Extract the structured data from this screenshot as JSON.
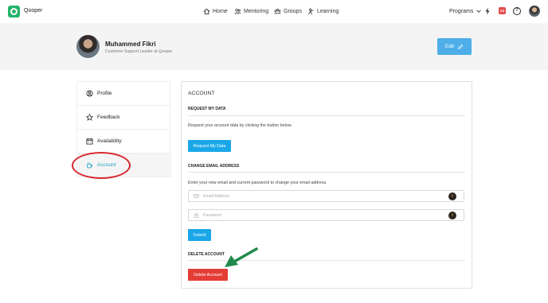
{
  "app": {
    "name": "Qooper"
  },
  "nav": {
    "links": [
      {
        "label": "Home",
        "icon": "home-icon"
      },
      {
        "label": "Mentoring",
        "icon": "mentoring-icon"
      },
      {
        "label": "Groups",
        "icon": "groups-icon"
      },
      {
        "label": "Learning",
        "icon": "learning-icon"
      }
    ],
    "programs_label": "Programs",
    "notification_count": "24",
    "help_symbol": "?"
  },
  "profile": {
    "name": "Muhammed Fikri",
    "role": "Customer Support Leader at Qooper",
    "edit_label": "Edit"
  },
  "sidebar": {
    "items": [
      {
        "label": "Profile",
        "icon": "user-circle-icon"
      },
      {
        "label": "Feedback",
        "icon": "star-icon"
      },
      {
        "label": "Availability",
        "icon": "calendar-icon"
      },
      {
        "label": "Account",
        "icon": "cup-icon",
        "active": true
      }
    ]
  },
  "account": {
    "title": "ACCOUNT",
    "request_data": {
      "heading": "REQUEST MY DATA",
      "description": "Request your account data by clicking the button below.",
      "button": "Request My Data"
    },
    "change_email": {
      "heading": "CHANGE EMAIL ADDRESS",
      "description": "Enter your new email and current password to change your email address.",
      "email_placeholder": "Email Address",
      "email_value": "",
      "password_placeholder": "Password",
      "password_value": "",
      "submit": "Submit"
    },
    "delete_account": {
      "heading": "DELETE ACCOUNT",
      "button": "Delete Account"
    }
  },
  "colors": {
    "brand": "#24b36b",
    "primary": "#1aa7e8",
    "danger": "#e43d35",
    "annotation_circle": "#d9262b",
    "annotation_arrow": "#1f8a4c"
  }
}
